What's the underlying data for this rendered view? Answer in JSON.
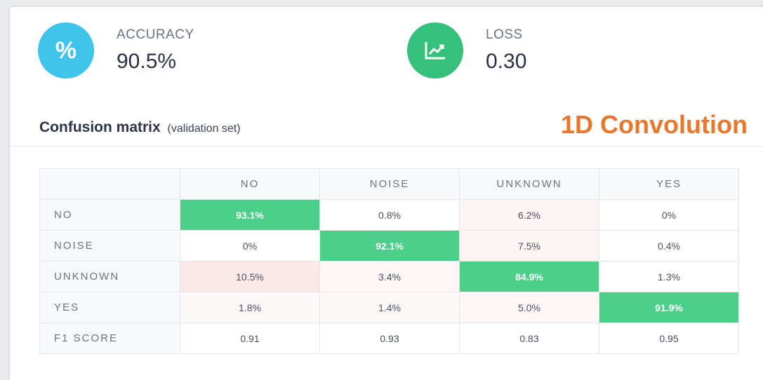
{
  "accuracy": {
    "label": "ACCURACY",
    "value": "90.5%",
    "icon": "percent-icon",
    "color": "#3fc4ec",
    "symbol": "%"
  },
  "loss": {
    "label": "LOSS",
    "value": "0.30",
    "icon": "trend-chart-icon",
    "color": "#35c07c"
  },
  "matrix": {
    "title": "Confusion matrix",
    "subtitle": "(validation set)",
    "columns": [
      "NO",
      "NOISE",
      "UNKNOWN",
      "YES"
    ],
    "rows": [
      {
        "label": "NO",
        "cells": [
          "93.1%",
          "0.8%",
          "6.2%",
          "0%"
        ]
      },
      {
        "label": "NOISE",
        "cells": [
          "0%",
          "92.1%",
          "7.5%",
          "0.4%"
        ]
      },
      {
        "label": "UNKNOWN",
        "cells": [
          "10.5%",
          "3.4%",
          "84.9%",
          "1.3%"
        ]
      },
      {
        "label": "YES",
        "cells": [
          "1.8%",
          "1.4%",
          "5.0%",
          "91.9%"
        ]
      }
    ],
    "f1": {
      "label": "F1 SCORE",
      "cells": [
        "0.91",
        "0.93",
        "0.83",
        "0.95"
      ]
    },
    "colors": {
      "diagonal": "#4ccf88",
      "high": "#fbe9ea",
      "low": "#fdf6f6"
    }
  },
  "model_title": {
    "text": "1D Convolution",
    "color": "#e8772e"
  }
}
